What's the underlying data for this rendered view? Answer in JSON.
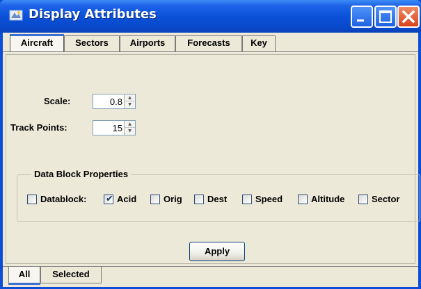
{
  "window": {
    "title": "Display Attributes",
    "icon": "window-app-icon",
    "controls": [
      "minimize-icon",
      "maximize-icon",
      "close-icon"
    ]
  },
  "tabs_top": [
    {
      "label": "Aircraft",
      "active": true
    },
    {
      "label": "Sectors",
      "active": false
    },
    {
      "label": "Airports",
      "active": false
    },
    {
      "label": "Forecasts",
      "active": false
    },
    {
      "label": "Key",
      "active": false
    }
  ],
  "fields": {
    "scale": {
      "label": "Scale:",
      "value": "0.8"
    },
    "track_points": {
      "label": "Track Points:",
      "value": "15"
    }
  },
  "data_block": {
    "title": "Data Block Properties",
    "checkboxes": [
      {
        "label": "Datablock:",
        "checked": false
      },
      {
        "label": "Acid",
        "checked": true
      },
      {
        "label": "Orig",
        "checked": false
      },
      {
        "label": "Dest",
        "checked": false
      },
      {
        "label": "Speed",
        "checked": false
      },
      {
        "label": "Altitude",
        "checked": false
      },
      {
        "label": "Sector",
        "checked": false
      }
    ]
  },
  "apply_label": "Apply",
  "tabs_bottom": [
    {
      "label": "All",
      "active": true
    },
    {
      "label": "Selected",
      "active": false
    }
  ],
  "colors": {
    "titlebar": "#0a4fd6",
    "client": "#ece9d8",
    "close": "#d8431c"
  }
}
